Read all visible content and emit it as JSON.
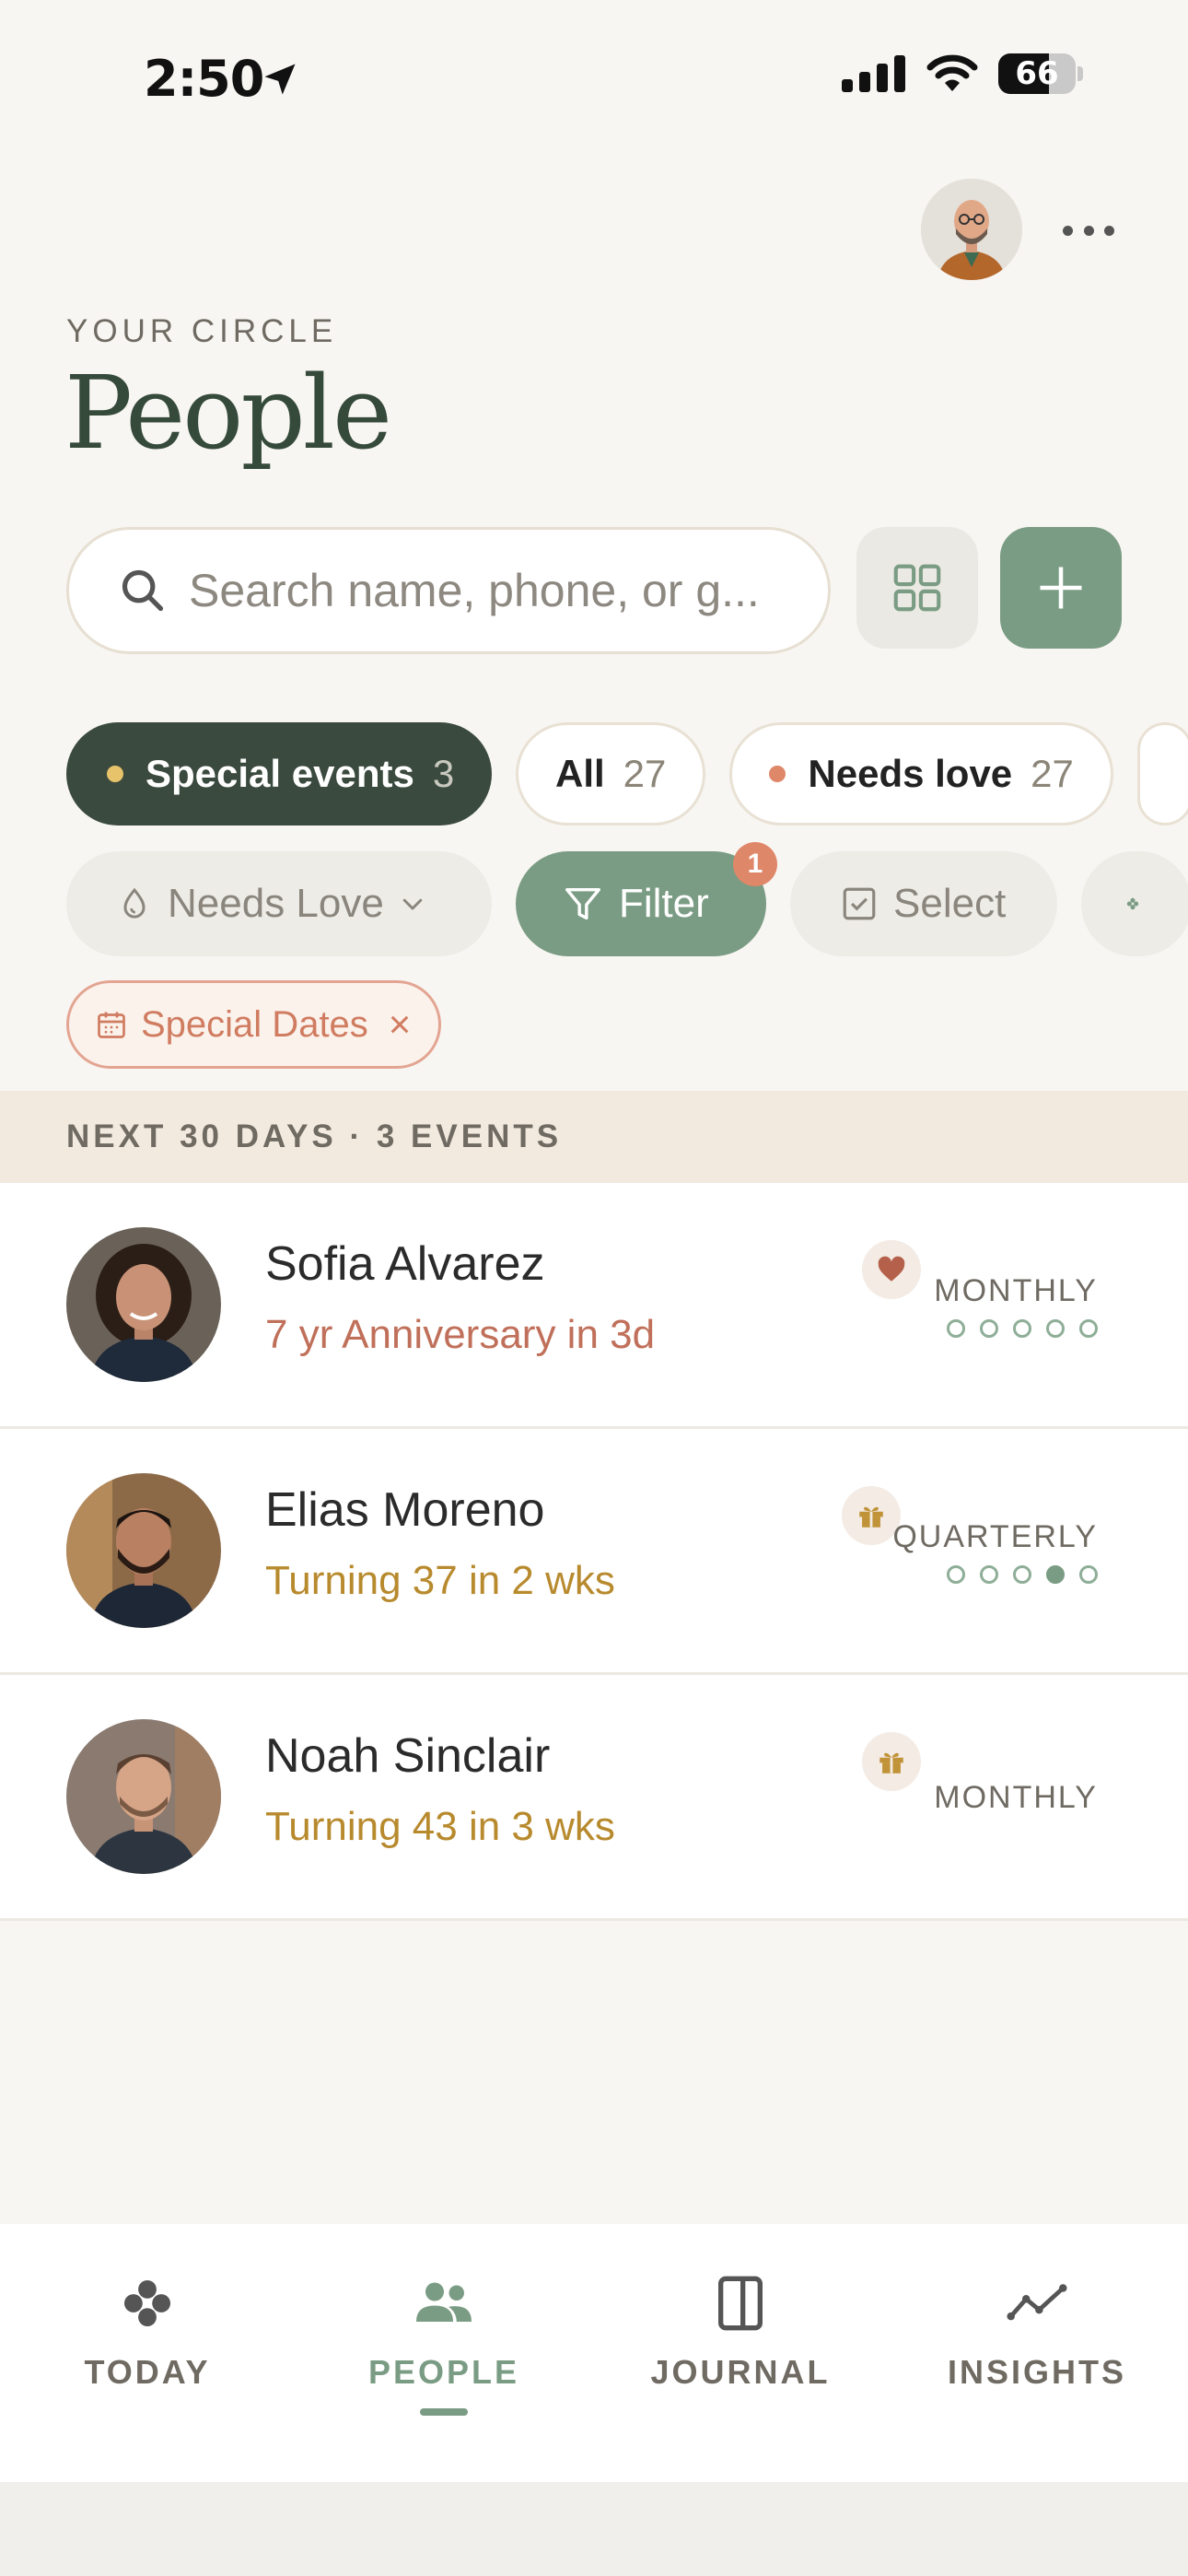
{
  "status_bar": {
    "time": "2:50",
    "battery": "66",
    "battery_level": 0.66
  },
  "header": {
    "eyebrow": "YOUR CIRCLE",
    "title": "People"
  },
  "search": {
    "placeholder": "Search name, phone, or g..."
  },
  "segments": [
    {
      "label": "Special events",
      "count": "3",
      "dot_color": "#e7c46b",
      "active": true
    },
    {
      "label": "All",
      "count": "27",
      "active": false
    },
    {
      "label": "Needs love",
      "count": "27",
      "dot_color": "#df8769",
      "active": false
    }
  ],
  "toolbar": {
    "needs_love_label": "Needs Love",
    "filter_label": "Filter",
    "filter_badge": "1",
    "select_label": "Select"
  },
  "active_filter": {
    "label": "Special Dates",
    "close": "×"
  },
  "section": {
    "title": "NEXT 30 DAYS · 3 EVENTS"
  },
  "people": [
    {
      "name": "Sofia Alvarez",
      "event": "7 yr Anniversary in 3d",
      "event_color": "#c0705a",
      "event_icon": "heart-icon",
      "frequency": "MONTHLY",
      "dots": [
        0,
        0,
        0,
        0,
        0
      ]
    },
    {
      "name": "Elias Moreno",
      "event": "Turning 37 in 2 wks",
      "event_color": "#b88a2e",
      "event_icon": "gift-icon",
      "frequency": "QUARTERLY",
      "dots": [
        0,
        0,
        0,
        1,
        0
      ]
    },
    {
      "name": "Noah Sinclair",
      "event": "Turning 43 in 3 wks",
      "event_color": "#b88a2e",
      "event_icon": "gift-icon",
      "frequency": "MONTHLY",
      "dots": []
    }
  ],
  "tabs": [
    {
      "label": "TODAY",
      "icon": "clover-icon",
      "active": false
    },
    {
      "label": "PEOPLE",
      "icon": "people-icon",
      "active": true
    },
    {
      "label": "JOURNAL",
      "icon": "journal-icon",
      "active": false
    },
    {
      "label": "INSIGHTS",
      "icon": "insights-icon",
      "active": false
    }
  ],
  "colors": {
    "accent": "#7b9c84",
    "dark_green": "#3b4a3e",
    "background": "#f8f6f2"
  }
}
